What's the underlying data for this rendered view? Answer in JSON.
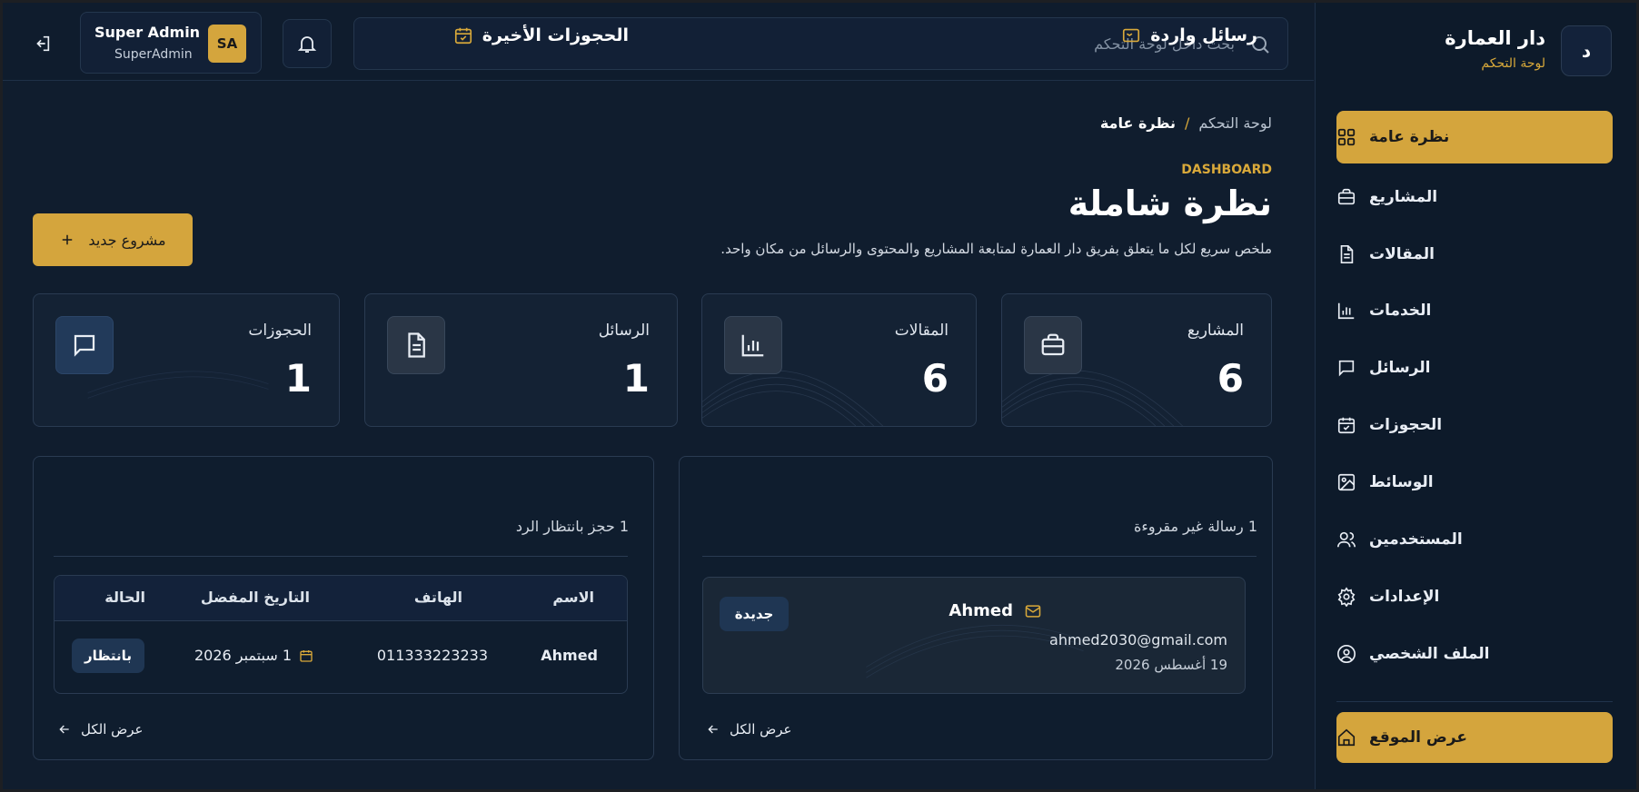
{
  "sidebar": {
    "logo_letter": "د",
    "brand_title": "دار العمارة",
    "brand_subtitle": "لوحة التحكم",
    "items": [
      {
        "label": "نظرة عامة",
        "icon": "grid-icon"
      },
      {
        "label": "المشاريع",
        "icon": "briefcase-icon"
      },
      {
        "label": "المقالات",
        "icon": "document-icon"
      },
      {
        "label": "الخدمات",
        "icon": "bar-chart-icon"
      },
      {
        "label": "الرسائل",
        "icon": "chat-icon"
      },
      {
        "label": "الحجوزات",
        "icon": "calendar-icon"
      },
      {
        "label": "الوسائط",
        "icon": "image-icon"
      },
      {
        "label": "المستخدمين",
        "icon": "users-icon"
      },
      {
        "label": "الإعدادات",
        "icon": "gear-icon"
      },
      {
        "label": "الملف الشخصي",
        "icon": "user-circle-icon"
      }
    ],
    "site_button": "عرض الموقع"
  },
  "topbar": {
    "search_placeholder": "بحث داخل لوحة التحكم",
    "user_name": "Super Admin",
    "user_handle": "SuperAdmin",
    "user_initials": "SA"
  },
  "header": {
    "breadcrumb_root": "لوحة التحكم",
    "breadcrumb_sep": "/",
    "breadcrumb_current": "نظرة عامة",
    "eyebrow": "DASHBOARD",
    "title": "نظرة شاملة",
    "description": "ملخص سريع لكل ما يتعلق بفريق دار العمارة لمتابعة المشاريع والمحتوى والرسائل من مكان واحد.",
    "new_project": "مشروع جديد"
  },
  "stats": [
    {
      "label": "المشاريع",
      "value": "6",
      "icon": "briefcase-icon"
    },
    {
      "label": "المقالات",
      "value": "6",
      "icon": "bar-chart-icon"
    },
    {
      "label": "الرسائل",
      "value": "1",
      "icon": "document-icon"
    },
    {
      "label": "الحجوزات",
      "value": "1",
      "icon": "chat-icon"
    }
  ],
  "messages_panel": {
    "title": "رسائل واردة",
    "subtitle": "1 رسالة غير مقروءة",
    "message": {
      "name": "Ahmed",
      "email": "ahmed2030@gmail.com",
      "date": "19 أغسطس 2026",
      "badge": "جديدة"
    },
    "view_all": "عرض الكل"
  },
  "bookings_panel": {
    "title": "الحجوزات الأخيرة",
    "subtitle": "1 حجز بانتظار الرد",
    "columns": [
      "الاسم",
      "الهاتف",
      "التاريخ المفضل",
      "الحالة"
    ],
    "rows": [
      {
        "name": "Ahmed",
        "phone": "011333223233",
        "date": "1 سبتمبر 2026",
        "status": "بانتظار"
      }
    ],
    "view_all": "عرض الكل"
  },
  "colors": {
    "accent": "#d4a53d",
    "background": "#101d2e",
    "card": "#142234",
    "badge": "#1f3653"
  }
}
